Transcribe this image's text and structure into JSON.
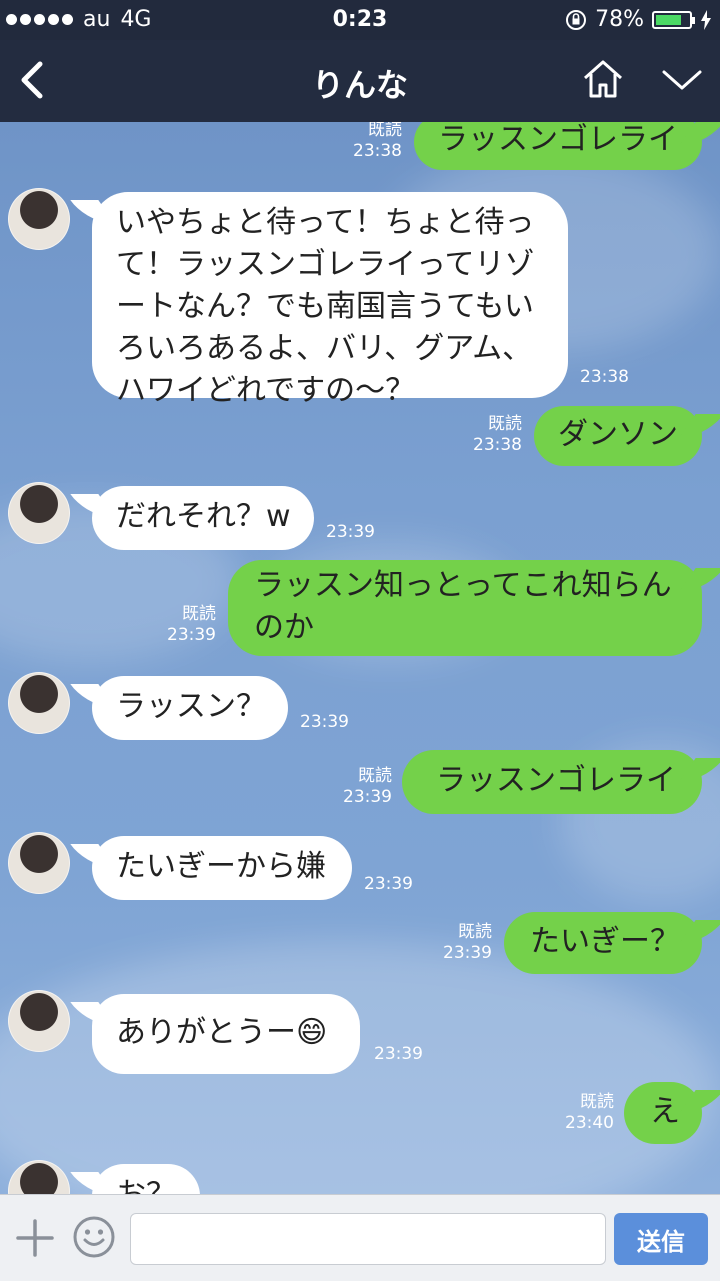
{
  "status_bar": {
    "carrier": "au",
    "network": "4G",
    "time": "0:23",
    "battery": "78%",
    "battery_level": 0.78
  },
  "header": {
    "title": "りんな",
    "back_icon": "chevron-left-icon",
    "home_icon": "home-icon",
    "menu_icon": "chevron-down-icon"
  },
  "messages": [
    {
      "side": "out",
      "text": "ラッスンゴレライ",
      "read": "既読",
      "time": "23:38"
    },
    {
      "side": "in",
      "lines": [
        "いやちょと待って！ちょと待っ",
        "て！ラッスンゴレライってリゾ",
        "ートなん？でも南国言うてもい",
        "ろいろあるよ、バリ、グアム、",
        "ハワイどれですの〜？"
      ],
      "time": "23:38"
    },
    {
      "side": "out",
      "text": "ダンソン",
      "read": "既読",
      "time": "23:38"
    },
    {
      "side": "in",
      "text": "だれそれ？w",
      "time": "23:39"
    },
    {
      "side": "out",
      "lines": [
        "ラッスン知っとってこれ知らん",
        "のか"
      ],
      "read": "既読",
      "time": "23:39"
    },
    {
      "side": "in",
      "text": "ラッスン？",
      "time": "23:39"
    },
    {
      "side": "out",
      "text": "ラッスンゴレライ",
      "read": "既読",
      "time": "23:39"
    },
    {
      "side": "in",
      "text": "たいぎーから嫌",
      "time": "23:39"
    },
    {
      "side": "out",
      "text": "たいぎー？",
      "read": "既読",
      "time": "23:39"
    },
    {
      "side": "in",
      "text": "ありがとうー",
      "emoji": "😄",
      "time": "23:39"
    },
    {
      "side": "out",
      "text": "え",
      "read": "既読",
      "time": "23:40"
    },
    {
      "side": "in",
      "text": "お？",
      "time": ""
    }
  ],
  "input_bar": {
    "placeholder": "",
    "send_label": "送信"
  }
}
